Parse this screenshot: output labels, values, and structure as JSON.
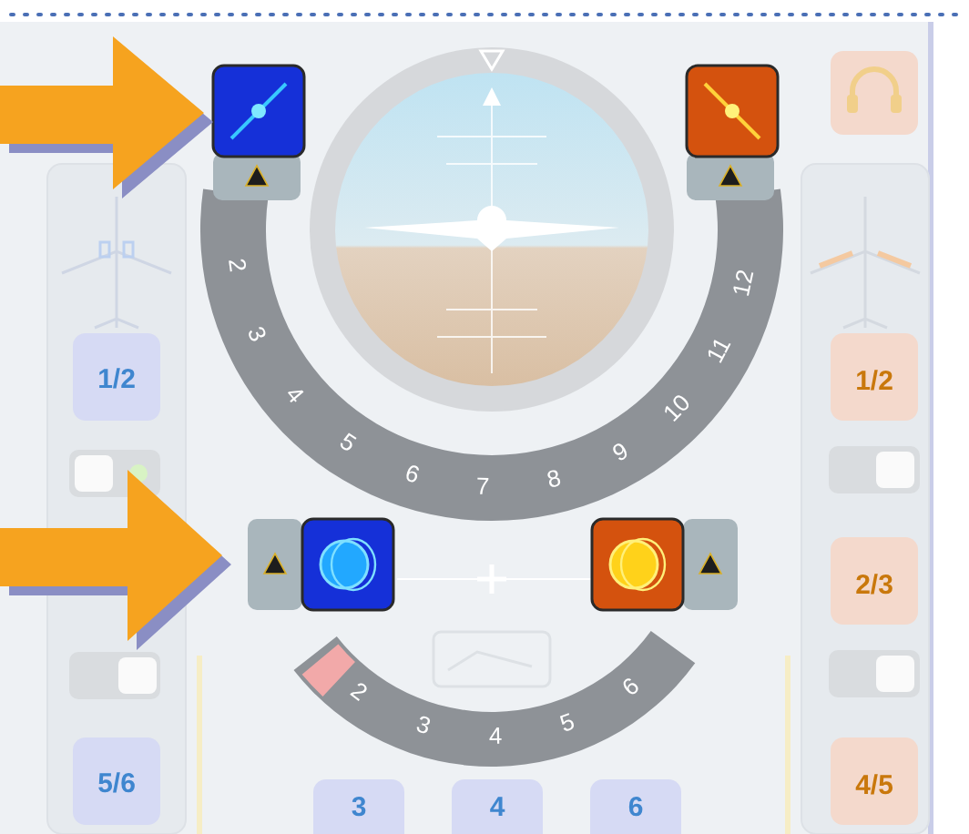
{
  "attitude_indicator": {
    "ring_labels": [
      "2",
      "3",
      "4",
      "5",
      "6",
      "7",
      "8",
      "9",
      "10",
      "11",
      "12"
    ]
  },
  "lower_scale": {
    "labels": [
      "2",
      "3",
      "4",
      "5",
      "6"
    ]
  },
  "main_buttons": [
    {
      "kind": "needle",
      "color": "#1530d8",
      "warning": true
    },
    {
      "kind": "needle",
      "color": "#d4520e",
      "warning": true
    },
    {
      "kind": "rings",
      "color": "#1530d8",
      "warning": true
    },
    {
      "kind": "rings",
      "color": "#d4520e",
      "warning": true
    }
  ],
  "left_panel": {
    "buttons": [
      "1/2",
      "5/6"
    ],
    "toggles": [
      {
        "on": true
      },
      {
        "on": false
      }
    ]
  },
  "right_panel": {
    "buttons": [
      "1/2",
      "2/3",
      "4/5"
    ],
    "toggles": [
      {
        "on": false
      },
      {
        "on": false
      }
    ]
  },
  "bottom_buttons": [
    "3",
    "4",
    "6"
  ]
}
